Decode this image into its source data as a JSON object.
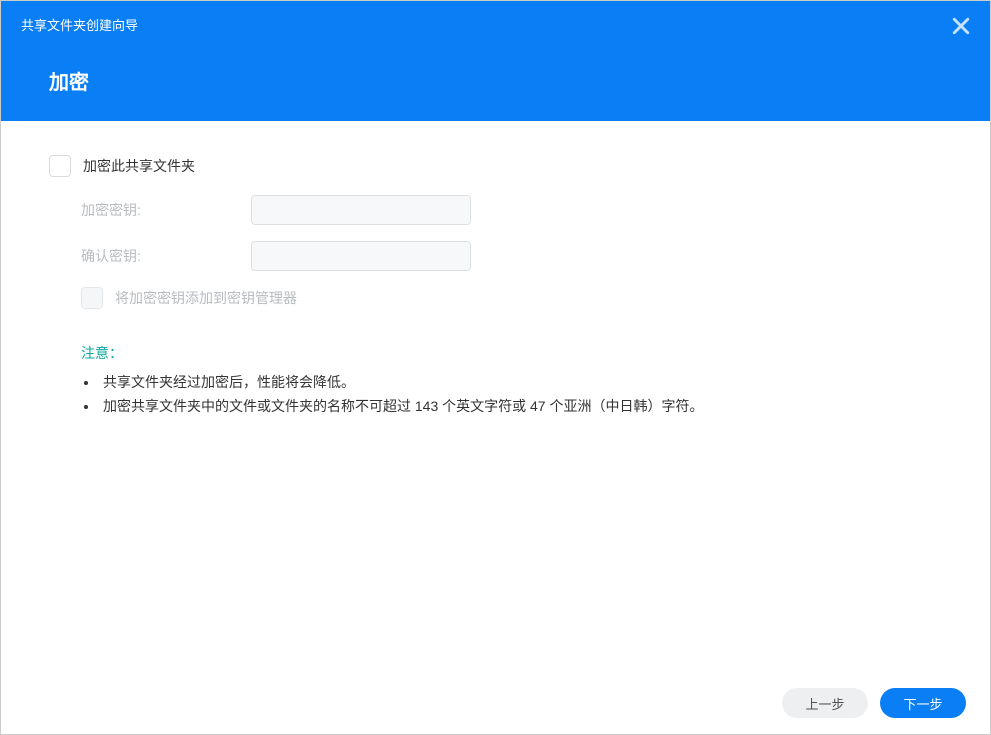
{
  "header": {
    "title": "共享文件夹创建向导",
    "subtitle": "加密"
  },
  "form": {
    "encrypt_checkbox_label": "加密此共享文件夹",
    "encryption_key_label": "加密密钥:",
    "confirm_key_label": "确认密钥:",
    "add_to_manager_label": "将加密密钥添加到密钥管理器"
  },
  "notice": {
    "title": "注意：",
    "items": [
      "共享文件夹经过加密后，性能将会降低。",
      "加密共享文件夹中的文件或文件夹的名称不可超过 143 个英文字符或 47 个亚洲（中日韩）字符。"
    ]
  },
  "footer": {
    "prev_label": "上一步",
    "next_label": "下一步"
  }
}
